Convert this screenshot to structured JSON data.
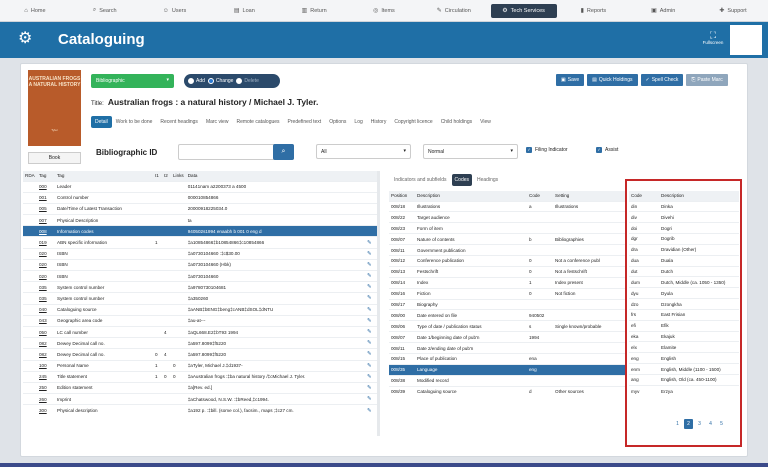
{
  "nav": [
    {
      "icon": "⌂",
      "label": "Home"
    },
    {
      "icon": "⌕",
      "label": "Search"
    },
    {
      "icon": "☺",
      "label": "Users"
    },
    {
      "icon": "▤",
      "label": "Loan"
    },
    {
      "icon": "▥",
      "label": "Return"
    },
    {
      "icon": "◎",
      "label": "Items"
    },
    {
      "icon": "✎",
      "label": "Circulation"
    },
    {
      "icon": "⚙",
      "label": "Tech Services"
    },
    {
      "icon": "▮",
      "label": "Reports"
    },
    {
      "icon": "▣",
      "label": "Admin"
    },
    {
      "icon": "✚",
      "label": "Support"
    }
  ],
  "banner": {
    "title": "Cataloguing",
    "fullscreen": "Fullscreen"
  },
  "book": {
    "cover_title": "AUSTRALIAN FROGS A NATURAL HISTORY",
    "cover_author": "Tyler",
    "button": "Book"
  },
  "record_type": "Bibliographic",
  "modes": [
    "Add",
    "Change",
    "Delete"
  ],
  "title_label": "Title:",
  "title_value": "Australian frogs : a natural history / Michael J. Tyler.",
  "tabs": [
    "Detail",
    "Work to be done",
    "Recent headings",
    "Marc view",
    "Remote catalogues",
    "Predefined text",
    "Options",
    "Log",
    "History",
    "Copyright licence",
    "Child holdings",
    "View"
  ],
  "actions": [
    "Save",
    "Quick Holdings",
    "Spell Check",
    "Paste Marc"
  ],
  "bib_id_label": "Bibliographic ID",
  "filter_all": "All",
  "filter_normal": "Normal",
  "filing_indicator": "Filing Indicator",
  "assist": "Assist",
  "marc_headers": [
    "RDA",
    "Tag",
    "Tag",
    "I1",
    "I2",
    "Links",
    "Data"
  ],
  "marc_rows": [
    [
      "",
      "000",
      "Leader",
      "",
      "",
      "",
      "01141nam a2200373 a 4500"
    ],
    [
      "",
      "001",
      "Control number",
      "",
      "",
      "",
      "000010854866"
    ],
    [
      "",
      "005",
      "Date/Time of Latest Transaction",
      "",
      "",
      "",
      "20000918225034.0"
    ],
    [
      "",
      "007",
      "Physical Description",
      "",
      "",
      "",
      "ta"
    ],
    [
      "",
      "008",
      "Information codes",
      "",
      "",
      "",
      "940502s1994 enaabh b 001 0 eng d"
    ],
    [
      "",
      "019",
      "ABN specific information",
      "1",
      "",
      "",
      "‡a10854866‡b10854866‡c10854866"
    ],
    [
      "",
      "020",
      "ISBN",
      "",
      "",
      "",
      "‡a0730104660 :‡c$30.00"
    ],
    [
      "",
      "020",
      "ISBN",
      "",
      "",
      "",
      "‡a0730104660 (Hbk)"
    ],
    [
      "",
      "020",
      "ISBN",
      "",
      "",
      "",
      "‡a0730104660"
    ],
    [
      "",
      "035",
      "System control number",
      "",
      "",
      "",
      "‡a9780730104681"
    ],
    [
      "",
      "035",
      "System control number",
      "",
      "",
      "",
      "‡a350260"
    ],
    [
      "",
      "040",
      "Cataloguing source",
      "",
      "",
      "",
      "‡aANB‡bENG‡beng‡cANB‡dSOL‡dNTU"
    ],
    [
      "",
      "043",
      "Geographic area code",
      "",
      "",
      "",
      "‡au-at---"
    ],
    [
      "",
      "050",
      "LC call number",
      "",
      "4",
      "",
      "‡aQL668.E2‡bT93 1994"
    ],
    [
      "",
      "082",
      "Dewey Decimal call no.",
      "",
      "",
      "",
      "‡a597.8099‡f5220"
    ],
    [
      "",
      "082",
      "Dewey Decimal call no.",
      "0",
      "4",
      "",
      "‡a597.8099‡f5220"
    ],
    [
      "",
      "100",
      "Personal Name",
      "1",
      "",
      "0",
      "‡aTyler, Michael J.‡d1937-"
    ],
    [
      "",
      "245",
      "Title statement",
      "1",
      "0",
      "0",
      "‡aAustralian frogs :‡ba natural history /‡cMichael J. Tyler."
    ],
    [
      "",
      "250",
      "Edition statement",
      "",
      "",
      "",
      "‡a[Rev. ed.]"
    ],
    [
      "",
      "260",
      "Imprint",
      "",
      "",
      "",
      "‡aChatswood, N.S.W. :‡bReed,‡c1994."
    ],
    [
      "",
      "300",
      "Physical description",
      "",
      "",
      "",
      "‡a192 p. :‡bill. (some col.), facsim., maps ;‡c27 cm."
    ]
  ],
  "subtabs": [
    "Indicators and subfields",
    "Codes",
    "Headings"
  ],
  "fixed_headers": [
    "Position",
    "Description",
    "Code",
    "Setting"
  ],
  "fixed_rows": [
    [
      "008/18",
      "Illustrations",
      "a",
      "Illustrations"
    ],
    [
      "008/22",
      "Target audience",
      "",
      ""
    ],
    [
      "008/23",
      "Form of item",
      "",
      ""
    ],
    [
      "008/07",
      "Nature of contents",
      "b",
      "Bibliographies"
    ],
    [
      "008/11",
      "Government publication",
      "",
      ""
    ],
    [
      "008/12",
      "Conference publication",
      "0",
      "Not a conference publ"
    ],
    [
      "008/13",
      "Festschrift",
      "0",
      "Not a festschrift"
    ],
    [
      "008/14",
      "Index",
      "1",
      "Index present"
    ],
    [
      "008/16",
      "Fiction",
      "0",
      "Not fiction"
    ],
    [
      "008/17",
      "Biography",
      "",
      ""
    ],
    [
      "008/00",
      "Date entered on file",
      "940502",
      ""
    ],
    [
      "008/06",
      "Type of date / publication status",
      "s",
      "Single known/probable"
    ],
    [
      "008/07",
      "Date 1/beginning date of pub'n",
      "1994",
      ""
    ],
    [
      "008/11",
      "Date 2/ending date of pub'n",
      "",
      ""
    ],
    [
      "008/15",
      "Place of publication",
      "ena",
      ""
    ],
    [
      "008/35",
      "Language",
      "eng",
      ""
    ],
    [
      "008/38",
      "Modified record",
      "",
      ""
    ],
    [
      "008/39",
      "Cataloguing source",
      "d",
      "Other sources"
    ]
  ],
  "code_headers": [
    "Code",
    "Description"
  ],
  "code_rows": [
    [
      "din",
      "Dinka"
    ],
    [
      "div",
      "Divehi"
    ],
    [
      "doi",
      "Dogri"
    ],
    [
      "dgr",
      "Dogrib"
    ],
    [
      "dra",
      "Dravidian (Other)"
    ],
    [
      "dua",
      "Duala"
    ],
    [
      "dut",
      "Dutch"
    ],
    [
      "dum",
      "Dutch, Middle (ca. 1050 - 1350)"
    ],
    [
      "dyu",
      "Dyula"
    ],
    [
      "dzo",
      "Dzongkha"
    ],
    [
      "frs",
      "East Frisian"
    ],
    [
      "efi",
      "Efik"
    ],
    [
      "eka",
      "Ekajuk"
    ],
    [
      "elx",
      "Elamite"
    ],
    [
      "eng",
      "English"
    ],
    [
      "enm",
      "English, Middle (1100 - 1500)"
    ],
    [
      "ang",
      "English, Old (ca. 450-1100)"
    ],
    [
      "myv",
      "Erzya"
    ]
  ],
  "pages": [
    "1",
    "2",
    "3",
    "4",
    "5"
  ],
  "active_page": "2"
}
